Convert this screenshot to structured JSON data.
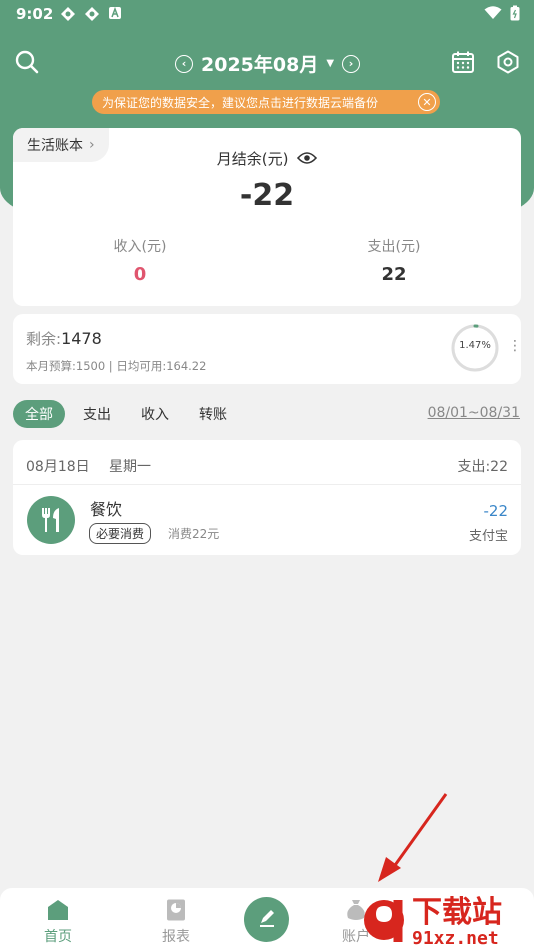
{
  "status": {
    "time": "9:02"
  },
  "header": {
    "month": "2025年08月",
    "banner": "为保证您的数据安全，建议您点击进行数据云端备份"
  },
  "summary": {
    "book": "生活账本",
    "title": "月结余(元)",
    "balance": "-22",
    "income_label": "收入(元)",
    "income_value": "0",
    "expense_label": "支出(元)",
    "expense_value": "22"
  },
  "budget": {
    "remaining_label": "剩余:",
    "remaining_value": "1478",
    "detail": "本月预算:1500 | 日均可用:164.22",
    "percent_label": "1.47%",
    "percent": 1.47
  },
  "tabs": [
    "全部",
    "支出",
    "收入",
    "转账"
  ],
  "date_range": "08/01~08/31",
  "day": {
    "date": "08月18日",
    "weekday": "星期一",
    "total": "支出:22",
    "entry": {
      "category": "餐饮",
      "tag": "必要消费",
      "note": "消费22元",
      "amount": "-22",
      "method": "支付宝"
    }
  },
  "nav": {
    "home": "首页",
    "report": "报表",
    "account": "账户"
  },
  "watermark": {
    "brand": "下载站",
    "site": "91xz.net"
  },
  "colors": {
    "primary": "#5c9e7c",
    "income": "#e0556e",
    "banner": "#f0a04b",
    "amount": "#3a86c8"
  }
}
